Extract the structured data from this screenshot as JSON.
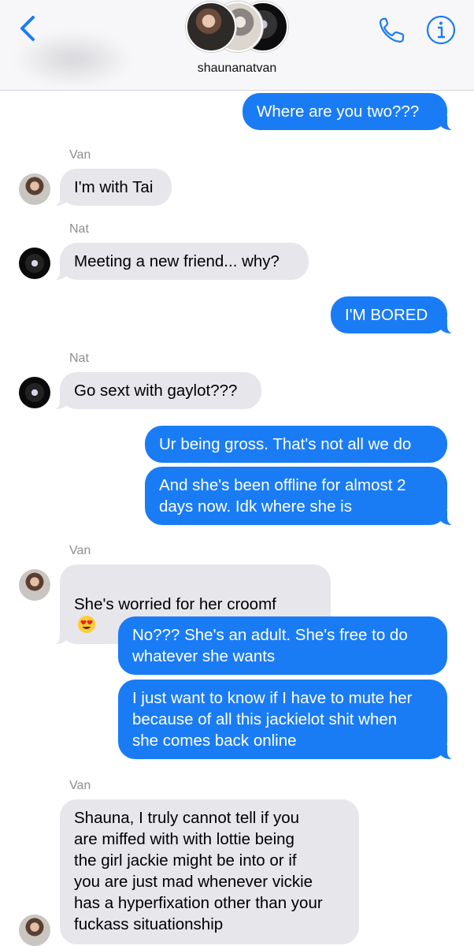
{
  "header": {
    "group_name": "shaunanatvan",
    "icons": [
      "chevron-left-icon",
      "phone-icon",
      "info-icon"
    ],
    "accent": "#1a7cf5"
  },
  "messages": [
    {
      "from": "me",
      "text": "Where are you two???"
    },
    {
      "sender": "Van",
      "text": "I'm with Tai"
    },
    {
      "sender": "Nat",
      "text": "Meeting a new friend... why?"
    },
    {
      "from": "me",
      "text": "I'M BORED"
    },
    {
      "sender": "Nat",
      "text": "Go sext with gaylot???"
    },
    {
      "from": "me",
      "text": "Ur being gross. That's not all we do"
    },
    {
      "from": "me",
      "text": "And she's been offline for almost 2\ndays now. Idk where she is"
    },
    {
      "sender": "Van",
      "text": "She's worried for her croomf",
      "emoji": "heart-eyes-emoji"
    },
    {
      "from": "me",
      "text": "No??? She's an adult. She's free to do\nwhatever she wants"
    },
    {
      "from": "me",
      "text": "I just want to know if I have to mute her\nbecause of all this jackielot shit when\nshe comes back online"
    },
    {
      "sender": "Van",
      "text": "Shauna, I truly cannot tell if you\nare miffed with with lottie being\nthe girl jackie might be into or if\nyou are just mad whenever vickie\nhas a hyperfixation other than your\nfuckass situationship"
    }
  ],
  "colors": {
    "outgoing_bubble": "#1a7cf5",
    "incoming_bubble": "#e6e6eb",
    "sender_label": "#8e8e93"
  }
}
